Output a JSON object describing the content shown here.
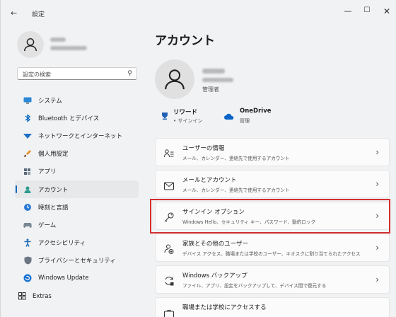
{
  "window": {
    "title": "設定",
    "back_glyph": "←",
    "minimize_glyph": "—",
    "maximize_glyph": "☐",
    "close_glyph": "✕"
  },
  "sidebar": {
    "search_placeholder": "設定の検索",
    "items": [
      {
        "label": "システム",
        "icon": "monitor-icon"
      },
      {
        "label": "Bluetooth とデバイス",
        "icon": "bluetooth-icon"
      },
      {
        "label": "ネットワークとインターネット",
        "icon": "wifi-icon"
      },
      {
        "label": "個人用設定",
        "icon": "brush-icon"
      },
      {
        "label": "アプリ",
        "icon": "apps-icon"
      },
      {
        "label": "アカウント",
        "icon": "person-icon",
        "active": true
      },
      {
        "label": "時刻と言語",
        "icon": "globe-clock-icon"
      },
      {
        "label": "ゲーム",
        "icon": "gamepad-icon"
      },
      {
        "label": "アクセシビリティ",
        "icon": "accessibility-icon"
      },
      {
        "label": "プライバシーとセキュリティ",
        "icon": "shield-icon"
      },
      {
        "label": "Windows Update",
        "icon": "update-icon"
      },
      {
        "label": "Extras",
        "icon": "extras-icon"
      }
    ]
  },
  "main": {
    "title": "アカウント",
    "role": "管理者",
    "services": [
      {
        "name": "リワード",
        "sub": "• サインイン",
        "icon": "trophy-icon"
      },
      {
        "name": "OneDrive",
        "sub": "管理",
        "icon": "cloud-icon"
      }
    ],
    "cards": [
      {
        "title": "ユーザーの情報",
        "sub": "メール、カレンダー、連絡先で使用するアカウント",
        "icon": "user-info-icon"
      },
      {
        "title": "メールとアカウント",
        "sub": "メール、カレンダー、連絡先で使用するアカウント",
        "icon": "mail-icon"
      },
      {
        "title": "サインイン オプション",
        "sub": "Windows Hello、セキュリティ キー、パスワード、動的ロック",
        "icon": "key-icon"
      },
      {
        "title": "家族とその他のユーザー",
        "sub": "デバイス アクセス、職場または学校のユーザー、キオスクに割り当てられたアクセス",
        "icon": "family-icon"
      },
      {
        "title": "Windows バックアップ",
        "sub": "ファイル、アプリ、設定をバックアップして、デバイス間で復元する",
        "icon": "backup-icon"
      },
      {
        "title": "職場または学校にアクセスする",
        "sub": "",
        "icon": "briefcase-icon"
      }
    ],
    "chevron": "›"
  },
  "colors": {
    "accent": "#0067c0",
    "highlight": "#d32f2f",
    "background": "#f0f2f4",
    "card": "#fbfbfb"
  }
}
